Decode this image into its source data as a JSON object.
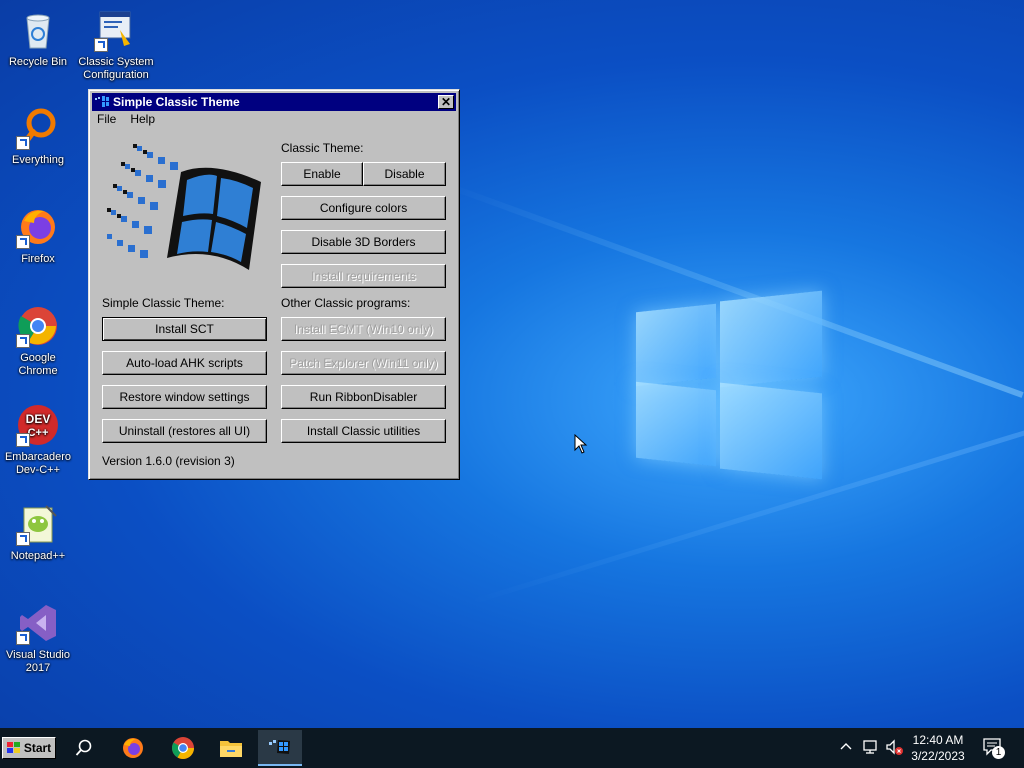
{
  "desktop": {
    "icons": [
      {
        "name": "recycle-bin",
        "label": "Recycle Bin"
      },
      {
        "name": "classic-system-configuration",
        "label": "Classic System Configuration"
      },
      {
        "name": "everything",
        "label": "Everything"
      },
      {
        "name": "firefox",
        "label": "Firefox"
      },
      {
        "name": "google-chrome",
        "label": "Google Chrome"
      },
      {
        "name": "embarcadero-dev-cpp",
        "label": "Embarcadero Dev-C++"
      },
      {
        "name": "notepad-plus-plus",
        "label": "Notepad++"
      },
      {
        "name": "visual-studio-2017",
        "label": "Visual Studio 2017"
      }
    ]
  },
  "window": {
    "title": "Simple Classic Theme",
    "close_glyph": "✕",
    "menu": [
      "File",
      "Help"
    ],
    "classic_theme_heading": "Classic Theme:",
    "enable": "Enable",
    "disable": "Disable",
    "configure_colors": "Configure colors",
    "disable_3d_borders": "Disable 3D Borders",
    "install_requirements": "Install requirements",
    "simple_classic_theme_heading": "Simple Classic Theme:",
    "install_sct": "Install SCT",
    "autoload_ahk": "Auto-load AHK scripts",
    "restore_window_settings": "Restore window settings",
    "uninstall": "Uninstall (restores all UI)",
    "other_programs_heading": "Other Classic programs:",
    "install_ecmt": "Install ECMT (Win10 only)",
    "patch_explorer": "Patch Explorer (Win11 only)",
    "run_ribbon_disabler": "Run RibbonDisabler",
    "install_classic_utilities": "Install Classic utilities",
    "version": "Version 1.6.0 (revision 3)"
  },
  "taskbar": {
    "start_label": "Start",
    "items": [
      "search-icon",
      "firefox-icon",
      "chrome-icon",
      "file-explorer-icon",
      "simple-classic-theme-icon"
    ],
    "time": "12:40 AM",
    "date": "3/22/2023",
    "notification_count": "1"
  },
  "colors": {
    "titlebar": "#000080",
    "window_face": "#c0c0c0",
    "taskbar": "#0c1822",
    "desktop": "#0b4fc4"
  }
}
